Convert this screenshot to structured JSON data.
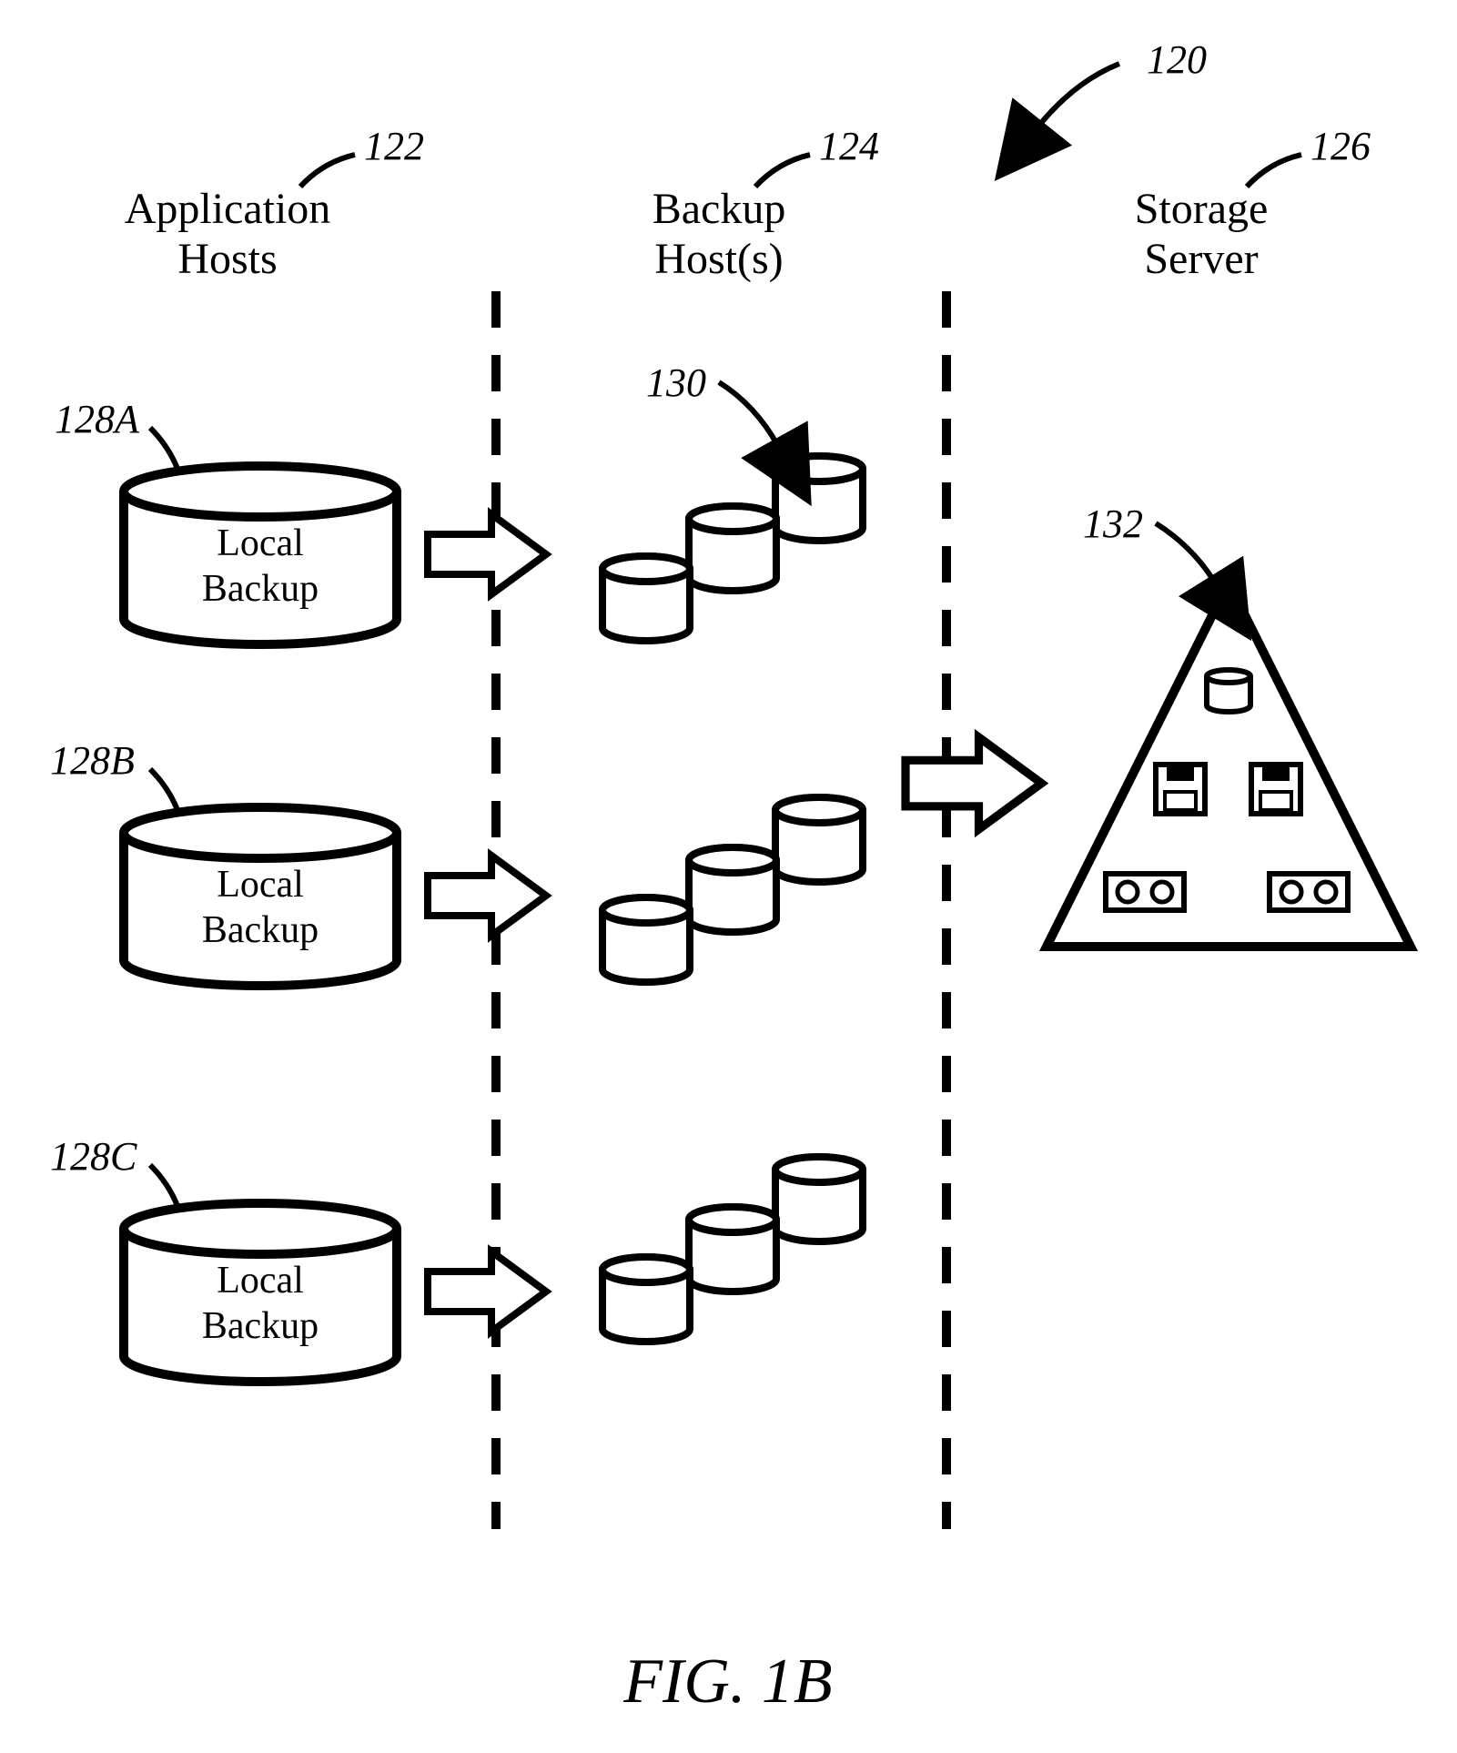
{
  "figure_caption": "FIG. 1B",
  "overall_ref": "120",
  "columns": {
    "app": {
      "line1": "Application",
      "line2": "Hosts",
      "ref": "122"
    },
    "backup": {
      "line1": "Backup",
      "line2": "Host(s)",
      "ref": "124"
    },
    "storage": {
      "line1": "Storage",
      "line2": "Server",
      "ref": "126"
    }
  },
  "local_backups": {
    "a": {
      "label1": "Local",
      "label2": "Backup",
      "ref": "128A"
    },
    "b": {
      "label1": "Local",
      "label2": "Backup",
      "ref": "128B"
    },
    "c": {
      "label1": "Local",
      "label2": "Backup",
      "ref": "128C"
    }
  },
  "snapshot_cluster_ref": "130",
  "pyramid_ref": "132"
}
